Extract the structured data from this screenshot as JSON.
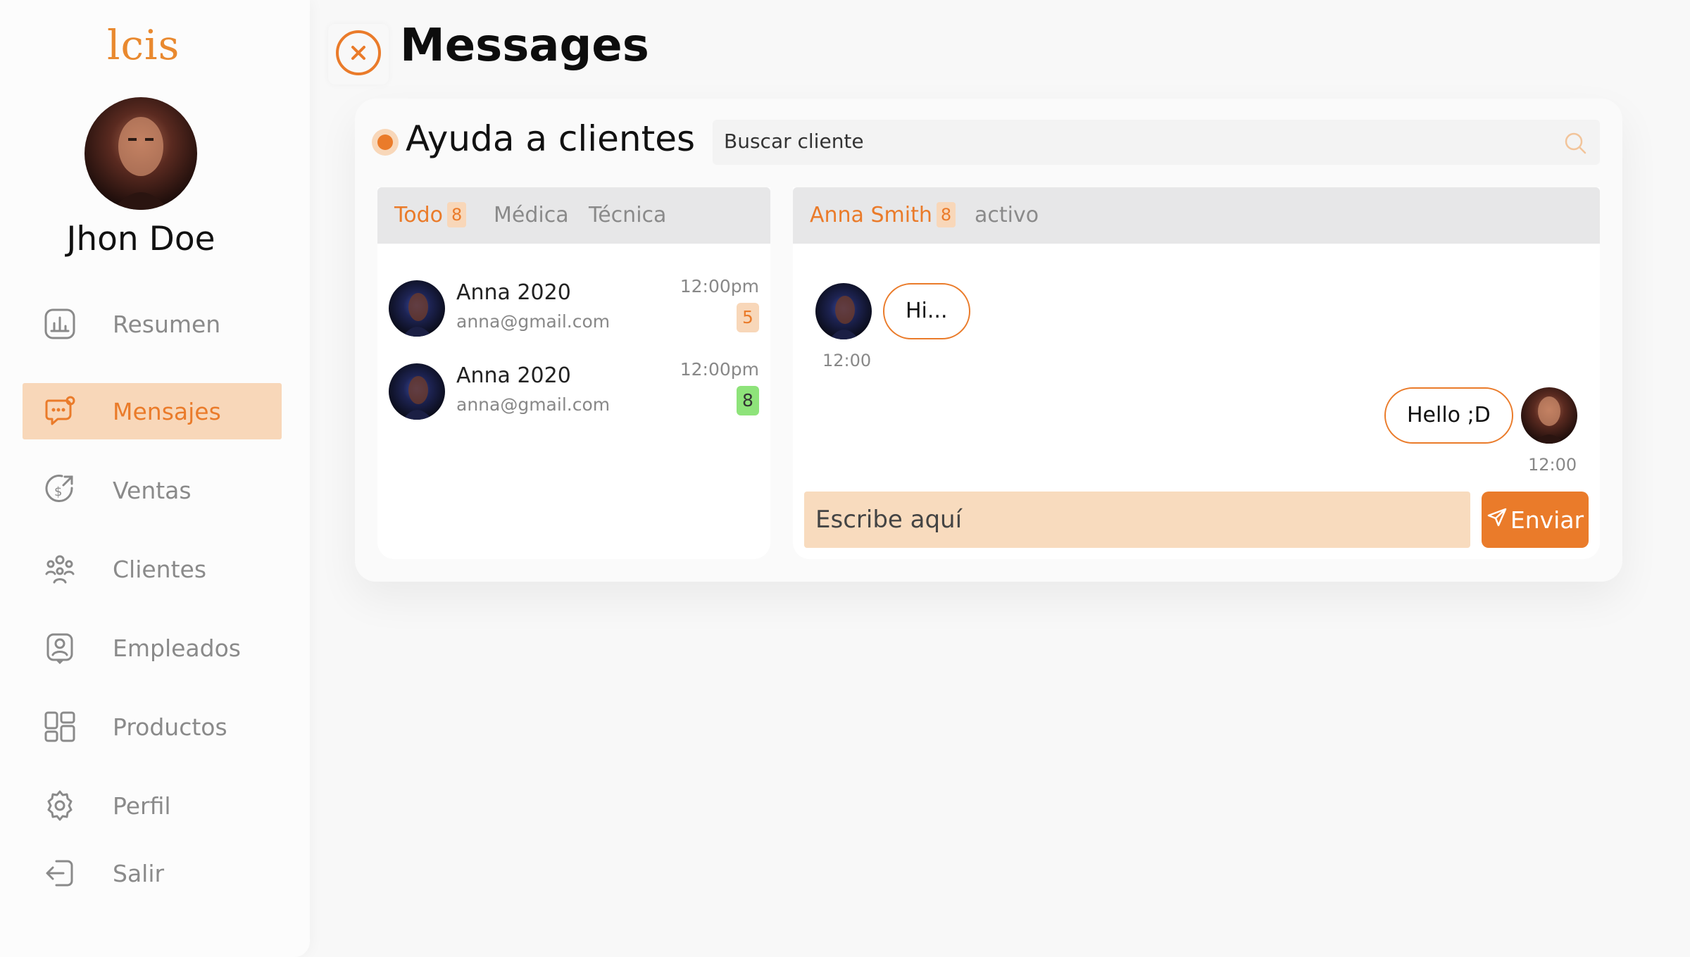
{
  "brand": {
    "logo_text": "lcis",
    "accent_color": "#ea7b2a",
    "accent_soft": "#f8d7b9"
  },
  "user": {
    "name": "Jhon Doe"
  },
  "sidebar": {
    "items": [
      {
        "label": "Resumen",
        "icon": "chart-icon",
        "active": false
      },
      {
        "label": "Mensajes",
        "icon": "chat-icon",
        "active": true
      },
      {
        "label": "Ventas",
        "icon": "sales-icon",
        "active": false
      },
      {
        "label": "Clientes",
        "icon": "users-icon",
        "active": false
      },
      {
        "label": "Empleados",
        "icon": "employee-icon",
        "active": false
      },
      {
        "label": "Productos",
        "icon": "grid-icon",
        "active": false
      },
      {
        "label": "Perfil",
        "icon": "gear-icon",
        "active": false
      },
      {
        "label": "Salir",
        "icon": "logout-icon",
        "active": false
      }
    ]
  },
  "header": {
    "title": "Messages",
    "close_icon": "close-icon"
  },
  "support": {
    "title": "Ayuda a clientes",
    "search_placeholder": "Buscar cliente"
  },
  "conversations": {
    "tabs": [
      {
        "label": "Todo",
        "count": "8",
        "active": true
      },
      {
        "label": "Médica",
        "active": false
      },
      {
        "label": "Técnica",
        "active": false
      }
    ],
    "items": [
      {
        "name": "Anna 2020",
        "email": "anna@gmail.com",
        "time": "12:00pm",
        "count": "5",
        "count_color": "#f8d7b9",
        "count_text_color": "#ea7b2a"
      },
      {
        "name": "Anna 2020",
        "email": "anna@gmail.com",
        "time": "12:00pm",
        "count": "8",
        "count_color": "#8ee37a",
        "count_text_color": "#333333"
      }
    ]
  },
  "chat": {
    "contact_name": "Anna Smith",
    "contact_count": "8",
    "status": "activo",
    "messages": [
      {
        "from": "contact",
        "text": "Hi...",
        "time": "12:00"
      },
      {
        "from": "me",
        "text": "Hello ;D",
        "time": "12:00"
      }
    ],
    "compose_placeholder": "Escribe aquí",
    "send_label": "Enviar"
  }
}
